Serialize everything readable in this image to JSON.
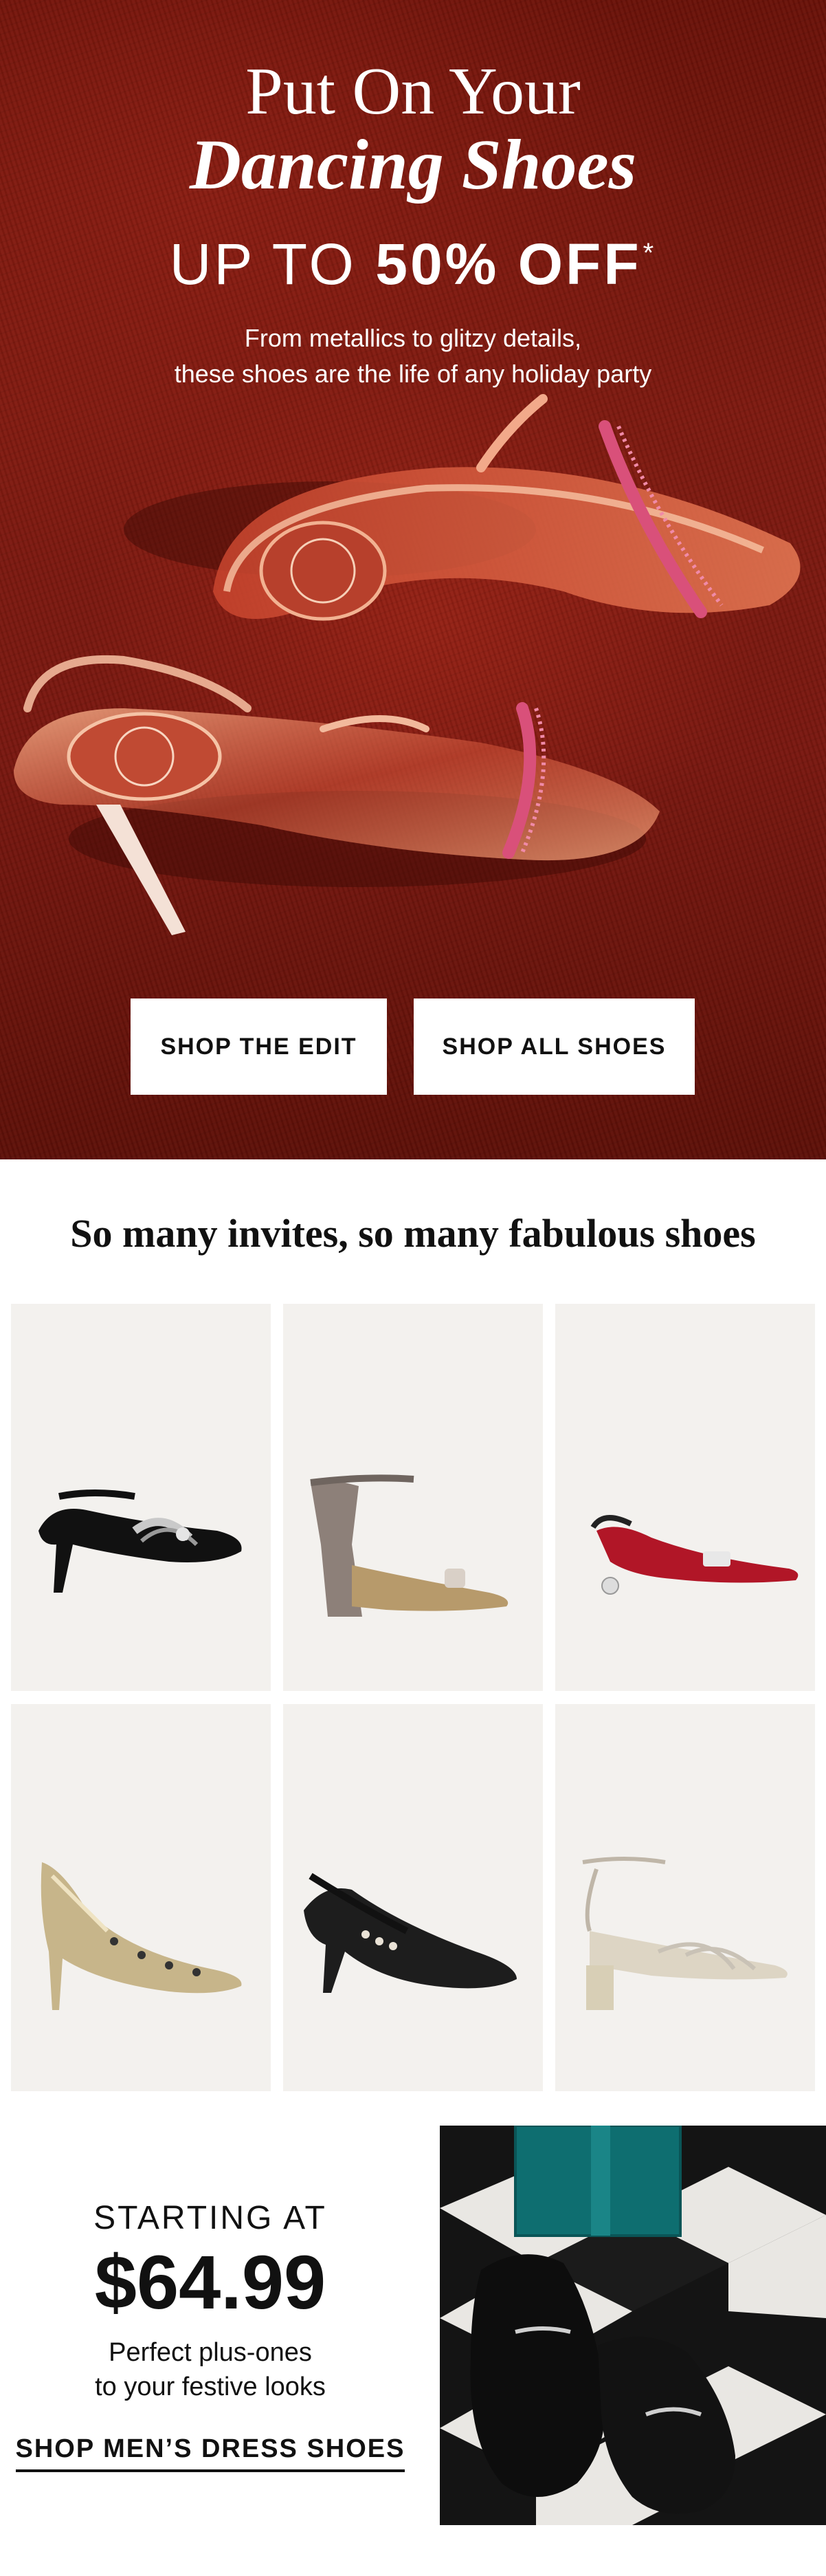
{
  "hero": {
    "title_line1": "Put On Your",
    "title_line2": "Dancing Shoes",
    "offer_prefix": "UP TO ",
    "offer_bold": "50% OFF",
    "offer_mark": "*",
    "subtitle_line1": "From metallics to glitzy details,",
    "subtitle_line2": "these shoes are the life of any holiday party",
    "buttons": [
      {
        "label": "SHOP THE EDIT"
      },
      {
        "label": "SHOP ALL SHOES"
      }
    ],
    "image": "rose-gold-crystal-strap-heels-on-red-carpet"
  },
  "grid": {
    "title": "So many invites, so many fabulous shoes",
    "products": [
      {
        "image": "black-sandal-with-crystal-knot"
      },
      {
        "image": "glitter-block-heel-sandal"
      },
      {
        "image": "red-satin-slingback-with-bow"
      },
      {
        "image": "gold-metallic-studded-pump"
      },
      {
        "image": "black-mary-jane-pump-with-jewels"
      },
      {
        "image": "silver-strappy-block-heel-sandal"
      }
    ]
  },
  "mens": {
    "starting_label": "STARTING AT",
    "price": "$64.99",
    "tagline_line1": "Perfect plus-ones",
    "tagline_line2": "to your festive looks",
    "link_label": "SHOP MEN’S DRESS SHOES",
    "image": "black-velvet-loafers-on-checkered-floor"
  },
  "colors": {
    "hero_red": "#7a1810",
    "tile_bg": "#f3f1ee",
    "text": "#111111",
    "white": "#ffffff"
  }
}
